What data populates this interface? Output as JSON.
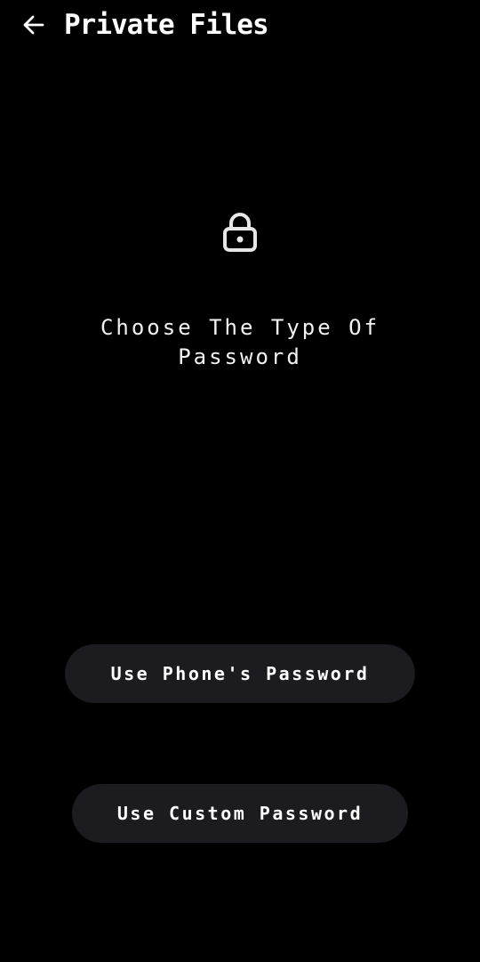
{
  "header": {
    "back_icon": "arrow-left-icon",
    "title": "Private Files"
  },
  "main": {
    "lock_icon": "lock-icon",
    "prompt": "Choose The Type Of Password"
  },
  "actions": {
    "phone_password_label": "Use Phone's Password",
    "custom_password_label": "Use Custom Password"
  },
  "colors": {
    "background": "#000000",
    "text": "#ffffff",
    "button_background": "#1b1b20",
    "icon": "#e6e6e6"
  }
}
